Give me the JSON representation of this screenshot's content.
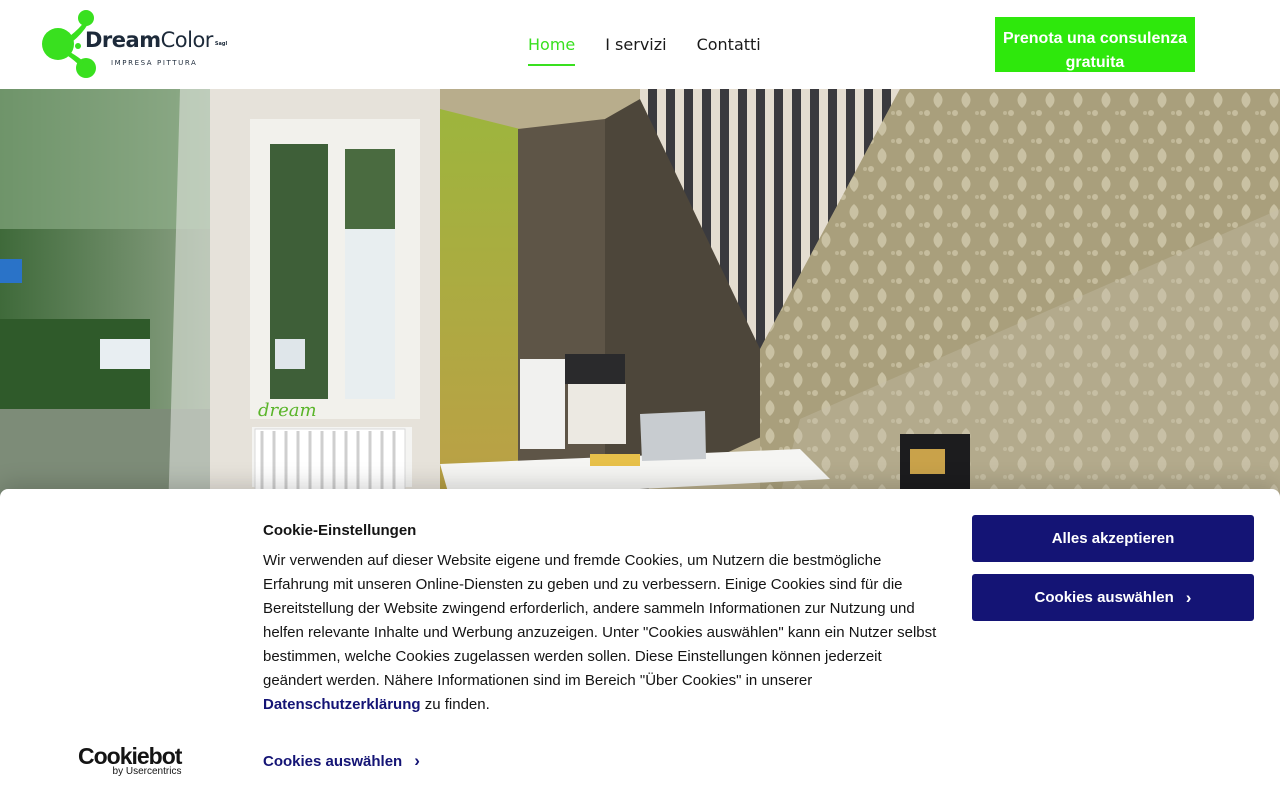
{
  "header": {
    "logo": {
      "name_bold": "Dream",
      "name_light": "Color",
      "suffix": "Sagl",
      "tagline": "IMPRESA PITTURA",
      "accent_color": "#39e01f"
    },
    "nav": [
      {
        "label": "Home",
        "active": true
      },
      {
        "label": "I servizi",
        "active": false
      },
      {
        "label": "Contatti",
        "active": false
      }
    ],
    "cta_label": "Prenota una consulenza gratuita",
    "cta_color": "#2ee80c"
  },
  "hero": {
    "image": "office-interior-photo",
    "wall_lettering": "dream"
  },
  "cookie_banner": {
    "title": "Cookie-Einstellungen",
    "text_before_link": "Wir verwenden auf dieser Website eigene und fremde Cookies, um Nutzern die bestmögliche Erfahrung mit unseren Online-Diensten zu geben und zu verbessern. Einige Cookies sind für die Bereitstellung der Website zwingend erforderlich, andere sammeln Informationen zur Nutzung und helfen relevante Inhalte und Werbung anzuzeigen. Unter \"Cookies auswählen\" kann ein Nutzer selbst bestimmen, welche Cookies zugelassen werden sollen. Diese Einstellungen können jederzeit geändert werden. Nähere Informationen sind im Bereich \"Über Cookies\" in unserer ",
    "link_text": "Datenschutzerklärung",
    "text_after_link": " zu finden.",
    "accept_label": "Alles akzeptieren",
    "select_label": "Cookies auswählen",
    "select_link_label": "Cookies auswählen",
    "brand_name": "Cookiebot",
    "brand_sub": "by Usercentrics",
    "button_color": "#141475"
  }
}
